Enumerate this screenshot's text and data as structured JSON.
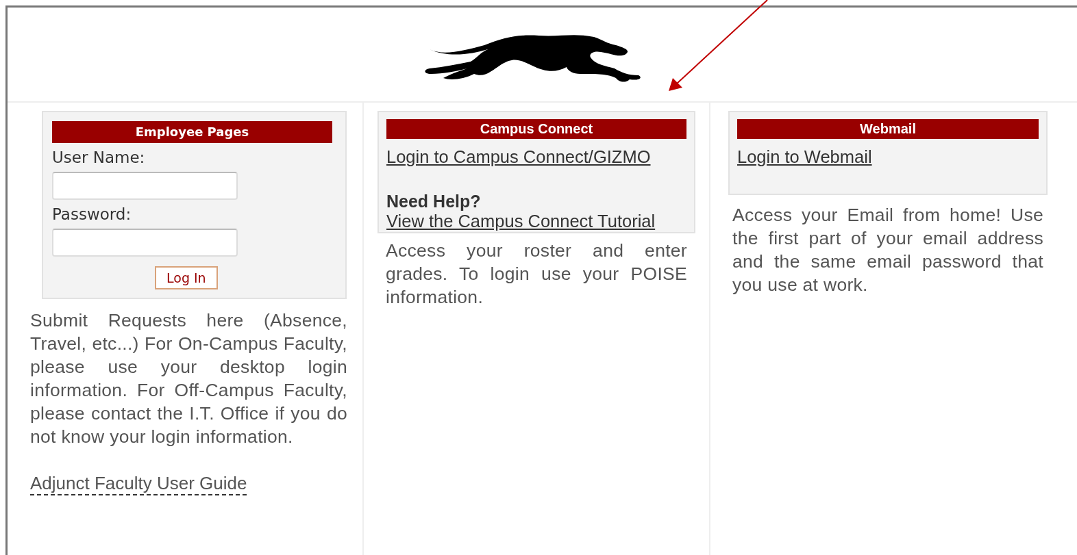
{
  "employee_panel": {
    "title": "Employee Pages",
    "fields": [
      {
        "label": "User Name:"
      },
      {
        "label": "Password:"
      }
    ],
    "button": "Log In",
    "description": "Submit Requests here (Absence, Travel, etc...) For On-Campus Faculty, please use your desktop login information. For Off-Campus Faculty, please contact the I.T. Office if you do not know your login information.",
    "guide_link": "Adjunct Faculty User Guide"
  },
  "campus_connect_panel": {
    "title": "Campus Connect",
    "link": "Login to Campus Connect/GIZMO",
    "help_heading": "Need Help?",
    "help_link": "View the Campus Connect Tutorial",
    "description": "Access your roster and enter grades. To login use your POISE information."
  },
  "webmail_panel": {
    "title": "Webmail",
    "link": "Login to Webmail",
    "description": "Access your Email from home! Use the first part of your email address and the same email password that you use at work."
  }
}
